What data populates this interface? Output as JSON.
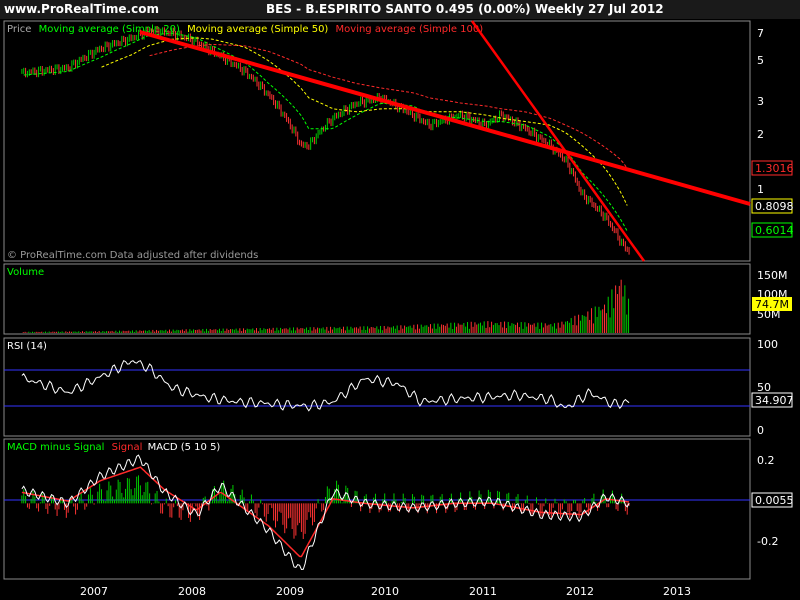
{
  "header": {
    "site": "www.ProRealTime.com",
    "headline": "BES - B.ESPIRITO SANTO    0.495 (0.00%)      Weekly  27 Jul 2012"
  },
  "price_panel": {
    "legend": {
      "price": "Price",
      "ma20": "Moving average (Simple 20)",
      "ma50": "Moving average (Simple 50)",
      "ma100": "Moving average (Simple 100)"
    },
    "footer": "© ProRealTime.com  Data adjusted after dividends",
    "y_ticks": [
      "7",
      "5",
      "3",
      "2",
      "1"
    ],
    "tags": {
      "ma100": "1.3016",
      "ma50": "0.8098",
      "ma20": "0.6014"
    }
  },
  "volume_panel": {
    "legend": "Volume",
    "y_ticks": [
      "150M",
      "100M",
      "50M"
    ],
    "tag": "74.7M"
  },
  "rsi_panel": {
    "legend": "RSI (14)",
    "y_ticks": [
      "100",
      "50",
      "0"
    ],
    "tag": "34.907"
  },
  "macd_panel": {
    "legend": {
      "hist": "MACD minus Signal",
      "signal": "Signal",
      "macd": "MACD (5 10 5)"
    },
    "y_ticks": [
      "0.2",
      "-0.2"
    ],
    "tag": "0.0055"
  },
  "x_ticks": [
    "2007",
    "2008",
    "2009",
    "2010",
    "2011",
    "2012",
    "2013"
  ],
  "colors": {
    "ma20": "#00ff00",
    "ma50": "#ffff00",
    "ma100": "#ff2a2a",
    "trendline": "#ff0000",
    "price_up": "#00cc00",
    "price_down": "#ff3333",
    "panel_border": "#8a8a8a",
    "rsi_line": "#ffffff",
    "rsi_bands": "#3333ff"
  },
  "chart_data": [
    {
      "type": "line",
      "panel": "price",
      "y_scale": "log",
      "ylim": [
        0.45,
        8
      ],
      "x": [
        "2006-03",
        "2006-09",
        "2007-01",
        "2007-05",
        "2007-07",
        "2007-10",
        "2008-01",
        "2008-03",
        "2008-07",
        "2008-10",
        "2009-02",
        "2009-03",
        "2009-06",
        "2009-09",
        "2009-12",
        "2010-04",
        "2010-06",
        "2010-10",
        "2011-01",
        "2011-03",
        "2011-06",
        "2011-09",
        "2011-11",
        "2012-01",
        "2012-04",
        "2012-06",
        "2012-07"
      ],
      "series": [
        {
          "name": "Price",
          "values": [
            4.3,
            4.6,
            5.8,
            6.6,
            7.2,
            7.0,
            6.3,
            5.6,
            4.4,
            3.3,
            1.8,
            1.8,
            2.5,
            3.0,
            3.2,
            2.6,
            2.3,
            2.6,
            2.3,
            2.6,
            2.2,
            1.8,
            1.5,
            1.0,
            0.75,
            0.55,
            0.495
          ]
        },
        {
          "name": "Moving average (Simple 20)",
          "values": [
            4.2,
            4.4,
            5.2,
            6.2,
            6.8,
            7.0,
            6.6,
            6.0,
            4.9,
            3.8,
            2.6,
            2.2,
            2.2,
            2.6,
            3.0,
            2.9,
            2.6,
            2.5,
            2.4,
            2.4,
            2.3,
            2.0,
            1.7,
            1.3,
            0.95,
            0.72,
            0.6014
          ]
        },
        {
          "name": "Moving average (Simple 50)",
          "values": [
            null,
            null,
            4.6,
            5.4,
            6.0,
            6.5,
            6.6,
            6.5,
            5.9,
            5.0,
            3.6,
            3.2,
            2.8,
            2.7,
            2.8,
            2.8,
            2.7,
            2.7,
            2.6,
            2.5,
            2.4,
            2.3,
            2.1,
            1.8,
            1.35,
            1.0,
            0.8098
          ]
        },
        {
          "name": "Moving average (Simple 100)",
          "values": [
            null,
            null,
            null,
            null,
            5.3,
            5.7,
            6.0,
            6.1,
            6.0,
            5.6,
            4.8,
            4.5,
            4.1,
            3.8,
            3.6,
            3.4,
            3.2,
            3.0,
            2.9,
            2.8,
            2.7,
            2.5,
            2.3,
            2.1,
            1.75,
            1.5,
            1.3016
          ]
        }
      ]
    },
    {
      "type": "bar",
      "panel": "volume",
      "ylim": [
        0,
        170
      ],
      "x": [
        "2007",
        "2008",
        "2009",
        "2010",
        "2011",
        "2011-10",
        "2012-01",
        "2012-04",
        "2012-06",
        "2012-07"
      ],
      "values": [
        5,
        10,
        14,
        18,
        30,
        25,
        50,
        80,
        155,
        74.7
      ]
    },
    {
      "type": "line",
      "panel": "rsi",
      "ylim": [
        0,
        100
      ],
      "x": [
        "2006-03",
        "2006-09",
        "2007-01",
        "2007-05",
        "2007-07",
        "2007-10",
        "2008-02",
        "2008-06",
        "2008-10",
        "2009-03",
        "2009-06",
        "2009-10",
        "2010-02",
        "2010-05",
        "2010-09",
        "2011-01",
        "2011-05",
        "2011-09",
        "2011-11",
        "2012-02",
        "2012-05",
        "2012-07"
      ],
      "values": [
        62,
        45,
        62,
        80,
        72,
        50,
        40,
        35,
        33,
        30,
        35,
        60,
        55,
        35,
        38,
        40,
        42,
        38,
        28,
        45,
        32,
        34.907
      ]
    },
    {
      "type": "line",
      "panel": "macd",
      "ylim": [
        -0.33,
        0.28
      ],
      "x": [
        "2006-03",
        "2006-09",
        "2007-01",
        "2007-06",
        "2007-09",
        "2008-01",
        "2008-04",
        "2008-10",
        "2009-02",
        "2009-06",
        "2009-10",
        "2010-04",
        "2010-09",
        "2011-02",
        "2011-08",
        "2012-01",
        "2012-04",
        "2012-07"
      ],
      "series": [
        {
          "name": "MACD",
          "values": [
            0.06,
            0.0,
            0.12,
            0.2,
            0.05,
            -0.05,
            0.08,
            -0.12,
            -0.3,
            0.05,
            0.0,
            -0.02,
            0.0,
            0.01,
            -0.05,
            -0.06,
            0.03,
            0.0
          ]
        },
        {
          "name": "Signal",
          "values": [
            0.05,
            0.01,
            0.1,
            0.16,
            0.06,
            -0.03,
            0.05,
            -0.1,
            -0.24,
            0.02,
            0.0,
            -0.02,
            0.0,
            0.0,
            -0.04,
            -0.05,
            0.02,
            0.0055
          ]
        }
      ]
    }
  ]
}
